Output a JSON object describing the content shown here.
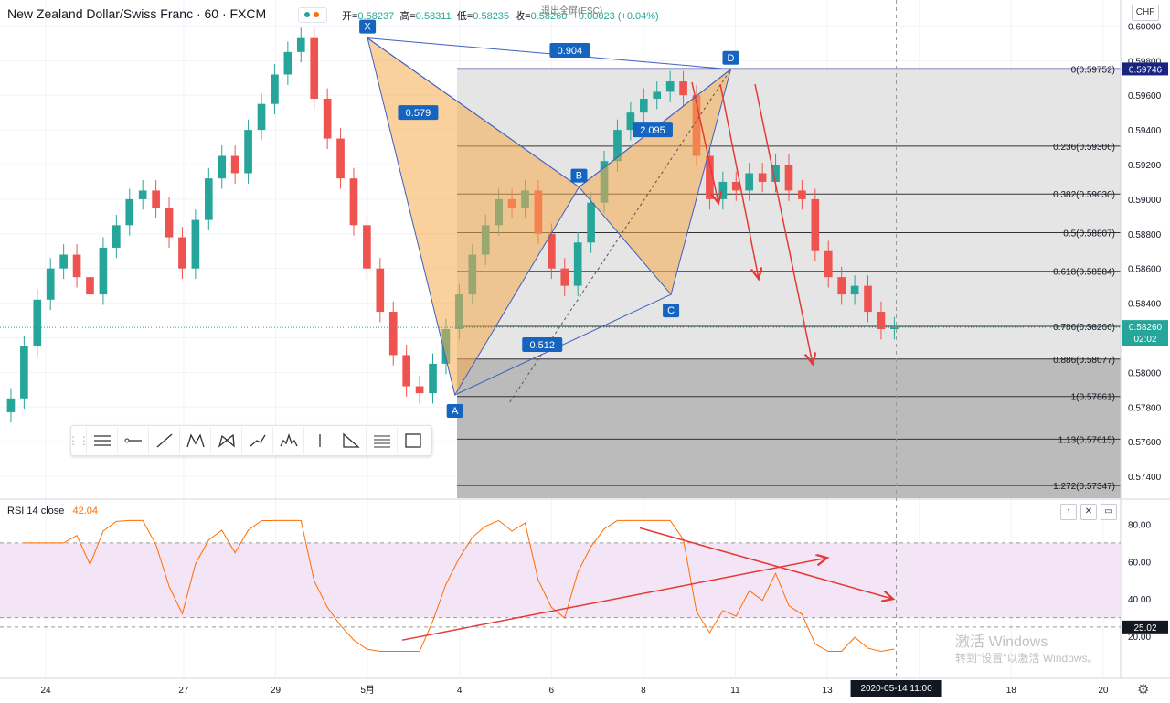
{
  "header": {
    "title": "New Zealand Dollar/Swiss Franc · 60 · FXCM",
    "ohlc": [
      {
        "label": "开",
        "value": "0.58237"
      },
      {
        "label": "高",
        "value": "0.58311"
      },
      {
        "label": "低",
        "value": "0.58235"
      },
      {
        "label": "收",
        "value": "0.58260"
      }
    ],
    "change": "+0.00023 (+0.04%)",
    "exit_fullscreen": "退出全屏(ESC)"
  },
  "currency": "CHF",
  "price_axis": {
    "ticks": [
      0.6,
      0.598,
      0.596,
      0.594,
      0.592,
      0.59,
      0.588,
      0.586,
      0.584,
      0.582,
      0.58,
      0.578,
      0.576,
      0.574
    ]
  },
  "price_tags": {
    "top": "0.59746",
    "last": "0.58260",
    "countdown": "02:02"
  },
  "time_axis": {
    "labels": [
      {
        "t": 0,
        "label": "24"
      },
      {
        "t": 3,
        "label": "27"
      },
      {
        "t": 5,
        "label": "29"
      },
      {
        "t": 7,
        "label": "5月"
      },
      {
        "t": 9,
        "label": "4"
      },
      {
        "t": 11,
        "label": "6"
      },
      {
        "t": 13,
        "label": "8"
      },
      {
        "t": 15,
        "label": "11"
      },
      {
        "t": 17,
        "label": "13"
      },
      {
        "t": 19,
        "label": "15"
      },
      {
        "t": 21,
        "label": "18"
      },
      {
        "t": 23,
        "label": "20"
      }
    ],
    "cursor_label": "2020-05-14  11:00",
    "cursor_t": 18.5
  },
  "fib_levels": [
    {
      "ratio": "0",
      "price": 0.59752,
      "label": "0(0.59752)"
    },
    {
      "ratio": "0.236",
      "price": 0.59306,
      "label": "0.236(0.59306)"
    },
    {
      "ratio": "0.382",
      "price": 0.5903,
      "label": "0.382(0.59030)"
    },
    {
      "ratio": "0.5",
      "price": 0.58807,
      "label": "0.5(0.58807)"
    },
    {
      "ratio": "0.618",
      "price": 0.58584,
      "label": "0.618(0.58584)"
    },
    {
      "ratio": "0.786",
      "price": 0.58266,
      "label": "0.786(0.58266)"
    },
    {
      "ratio": "0.886",
      "price": 0.58077,
      "label": "0.886(0.58077)"
    },
    {
      "ratio": "1",
      "price": 0.57861,
      "label": "1(0.57861)"
    },
    {
      "ratio": "1.13",
      "price": 0.57615,
      "label": "1.13(0.57615)"
    },
    {
      "ratio": "1.272",
      "price": 0.57347,
      "label": "1.272(0.57347)"
    }
  ],
  "pattern": {
    "points": [
      {
        "name": "X",
        "t": 7.0,
        "price": 0.5993
      },
      {
        "name": "A",
        "t": 8.9,
        "price": 0.5787
      },
      {
        "name": "B",
        "t": 11.6,
        "price": 0.5907
      },
      {
        "name": "C",
        "t": 13.6,
        "price": 0.5845
      },
      {
        "name": "D",
        "t": 14.9,
        "price": 0.5975
      }
    ],
    "ratios": [
      {
        "label": "0.904",
        "t": 11.4,
        "price": 0.5986
      },
      {
        "label": "0.579",
        "t": 8.1,
        "price": 0.595
      },
      {
        "label": "2.095",
        "t": 13.2,
        "price": 0.594
      },
      {
        "label": "0.512",
        "t": 10.8,
        "price": 0.5816
      }
    ]
  },
  "rsi": {
    "label": "RSI",
    "params": "14 close",
    "value": "42.04",
    "axis_ticks": [
      80,
      60,
      40,
      20
    ],
    "upper": 70,
    "lower": 30,
    "cursor_value": "25.02",
    "color": "#ff6d00",
    "band_color": "#f3e5f5"
  },
  "chart_data": {
    "type": "candlestick",
    "title": "New Zealand Dollar/Swiss Franc · 60 · FXCM",
    "ylim": [
      0.573,
      0.6015
    ],
    "close": [
      0.5785,
      0.5815,
      0.5842,
      0.586,
      0.5868,
      0.5855,
      0.5845,
      0.5872,
      0.5885,
      0.59,
      0.5905,
      0.5895,
      0.5878,
      0.586,
      0.5888,
      0.5912,
      0.5925,
      0.5915,
      0.594,
      0.5955,
      0.5972,
      0.5985,
      0.5993,
      0.5958,
      0.5935,
      0.5912,
      0.5885,
      0.586,
      0.5835,
      0.581,
      0.5792,
      0.5788,
      0.5805,
      0.5825,
      0.5845,
      0.5868,
      0.5885,
      0.59,
      0.5895,
      0.5905,
      0.588,
      0.586,
      0.585,
      0.5875,
      0.5898,
      0.5922,
      0.594,
      0.595,
      0.5958,
      0.5962,
      0.5968,
      0.596,
      0.5925,
      0.59,
      0.591,
      0.5905,
      0.5915,
      0.591,
      0.592,
      0.5905,
      0.59,
      0.587,
      0.5855,
      0.5845,
      0.585,
      0.5835,
      0.5825,
      0.5826
    ]
  }
}
